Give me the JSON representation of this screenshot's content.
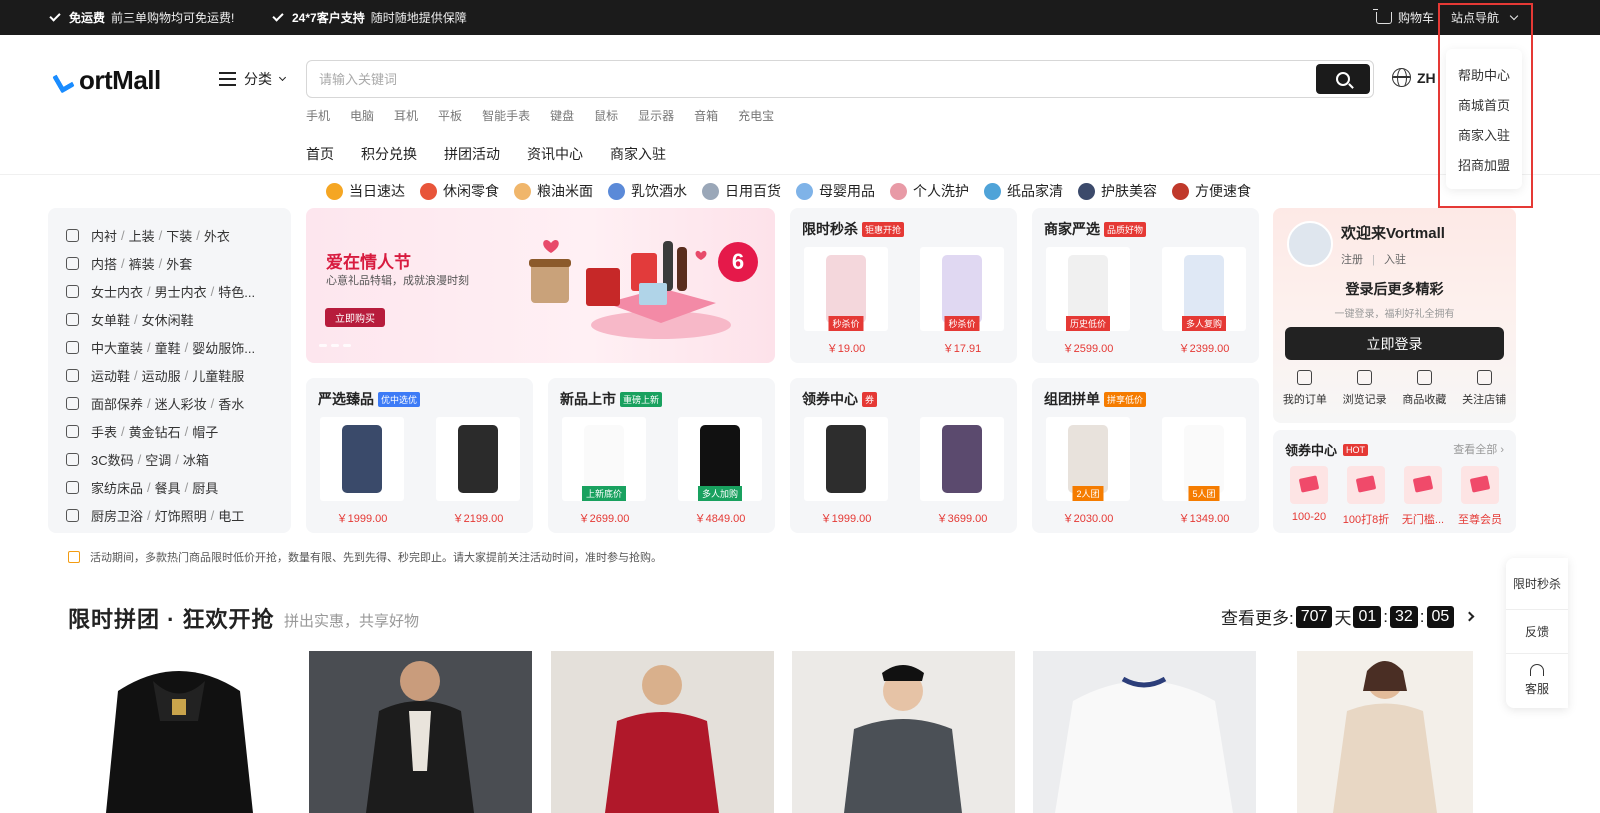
{
  "topbar": {
    "shipping_bold": "免运费",
    "shipping_text": "前三单购物均可免运费!",
    "support_bold": "24*7客户支持",
    "support_text": "随时随地提供保障",
    "cart": "购物车",
    "site_nav": "站点导航"
  },
  "dropdown": [
    "帮助中心",
    "商城首页",
    "商家入驻",
    "招商加盟"
  ],
  "logo": "ortMall",
  "category_button": "分类",
  "search": {
    "placeholder": "请输入关键词"
  },
  "language": "ZH",
  "hot_words": [
    "手机",
    "电脑",
    "耳机",
    "平板",
    "智能手表",
    "键盘",
    "鼠标",
    "显示器",
    "音箱",
    "充电宝"
  ],
  "nav": [
    "首页",
    "积分兑换",
    "拼团活动",
    "资讯中心",
    "商家入驻"
  ],
  "quick_categories": [
    {
      "label": "当日速达",
      "color": "#f5a623"
    },
    {
      "label": "休闲零食",
      "color": "#e8553a"
    },
    {
      "label": "粮油米面",
      "color": "#f0b66b"
    },
    {
      "label": "乳饮酒水",
      "color": "#5b8ad8"
    },
    {
      "label": "日用百货",
      "color": "#9aa7b8"
    },
    {
      "label": "母婴用品",
      "color": "#7fb3e8"
    },
    {
      "label": "个人洗护",
      "color": "#e89aa6"
    },
    {
      "label": "纸品家清",
      "color": "#4fa3d8"
    },
    {
      "label": "护肤美容",
      "color": "#3c4a6b"
    },
    {
      "label": "方便速食",
      "color": "#c0392b"
    }
  ],
  "category_rows": [
    [
      "内衬",
      "上装",
      "下装",
      "外衣"
    ],
    [
      "内搭",
      "裤装",
      "外套"
    ],
    [
      "女士内衣",
      "男士内衣",
      "特色..."
    ],
    [
      "女单鞋",
      "女休闲鞋"
    ],
    [
      "中大童装",
      "童鞋",
      "婴幼服饰..."
    ],
    [
      "运动鞋",
      "运动服",
      "儿童鞋服"
    ],
    [
      "面部保养",
      "迷人彩妆",
      "香水"
    ],
    [
      "手表",
      "黄金钻石",
      "帽子"
    ],
    [
      "3C数码",
      "空调",
      "冰箱"
    ],
    [
      "家纺床品",
      "餐具",
      "厨具"
    ],
    [
      "厨房卫浴",
      "灯饰照明",
      "电工"
    ]
  ],
  "banner": {
    "title": "爱在情人节",
    "subtitle": "心意礼品特辑，成就浪漫时刻",
    "button": "立即购买",
    "badge": "6"
  },
  "cards": [
    {
      "title": "限时秒杀",
      "tag": "钜惠开抢",
      "tag_color": "#e53935",
      "items": [
        {
          "price": "￥19.00",
          "label": "秒杀价"
        },
        {
          "price": "￥17.91",
          "label": "秒杀价"
        }
      ]
    },
    {
      "title": "商家严选",
      "tag": "品质好物",
      "tag_color": "#e53935",
      "items": [
        {
          "price": "￥2599.00",
          "label": "历史低价"
        },
        {
          "price": "￥2399.00",
          "label": "多人复购"
        }
      ]
    },
    {
      "title": "严选臻品",
      "tag": "优中选优",
      "tag_color": "#3d7bf6",
      "items": [
        {
          "price": "￥1999.00",
          "label": ""
        },
        {
          "price": "￥2199.00",
          "label": ""
        }
      ]
    },
    {
      "title": "新品上市",
      "tag": "重磅上新",
      "tag_color": "#19a15f",
      "items": [
        {
          "price": "￥2699.00",
          "label": "上新底价"
        },
        {
          "price": "￥4849.00",
          "label": "多人加购"
        }
      ]
    },
    {
      "title": "领券中心",
      "tag": "券",
      "tag_color": "#e53935",
      "items": [
        {
          "price": "￥1999.00",
          "label": ""
        },
        {
          "price": "￥3699.00",
          "label": ""
        }
      ]
    },
    {
      "title": "组团拼单",
      "tag": "拼享低价",
      "tag_color": "#f57c00",
      "items": [
        {
          "price": "￥2030.00",
          "label": "2人团"
        },
        {
          "price": "￥1349.00",
          "label": "5人团"
        }
      ]
    }
  ],
  "user": {
    "welcome": "欢迎来Vortmall",
    "register": "注册",
    "login_link": "入驻",
    "tip": "登录后更多精彩",
    "tip2": "一键登录，福利好礼全拥有",
    "login_button": "立即登录",
    "actions": [
      "我的订单",
      "浏览记录",
      "商品收藏",
      "关注店铺"
    ]
  },
  "coupon_center": {
    "title": "领券中心",
    "hot": "HOT",
    "more": "查看全部",
    "coupons": [
      "100-20",
      "100打8折",
      "无门槛...",
      "至尊会员"
    ]
  },
  "notice": "活动期间，多款热门商品限时低价开抢，数量有限、先到先得、秒完即止。请大家提前关注活动时间，准时参与抢购。",
  "section": {
    "title": "限时拼团 · 狂欢开抢",
    "subtitle": "拼出实惠，共享好物"
  },
  "countdown": {
    "label": "查看更多:",
    "days": "707",
    "day_unit": "天",
    "hours": "01",
    "minutes": "32",
    "seconds": "05"
  },
  "sidebar": [
    "限时秒杀",
    "反馈",
    "客服"
  ]
}
